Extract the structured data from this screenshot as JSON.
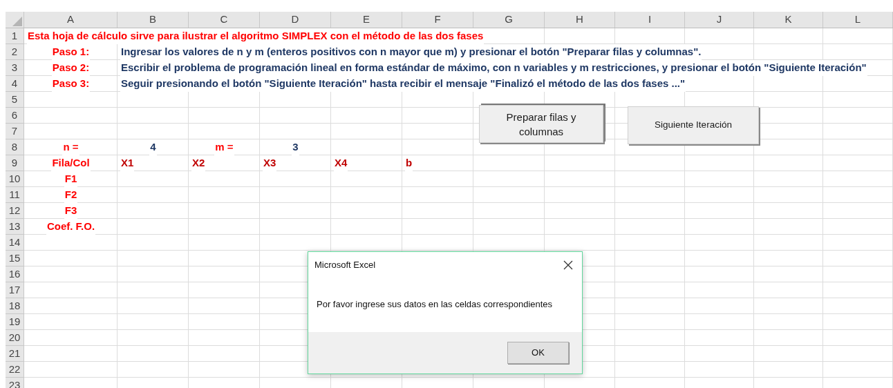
{
  "sheet": {
    "columns": [
      "A",
      "B",
      "C",
      "D",
      "E",
      "F",
      "G",
      "H",
      "I",
      "J",
      "K",
      "L"
    ],
    "rows": [
      {
        "number": "1",
        "cells": [
          {
            "kind": "title",
            "text": "Esta hoja de cálculo sirve para ilustrar el algoritmo SIMPLEX con el método de las dos fases"
          }
        ]
      },
      {
        "number": "2",
        "cells": [
          {
            "kind": "step",
            "text": "Paso 1:"
          }
        ],
        "note": "Ingresar los valores de n y m (enteros positivos con n mayor que m) y presionar el botón \"Preparar filas y columnas\"."
      },
      {
        "number": "3",
        "cells": [
          {
            "kind": "step",
            "text": "Paso 2:"
          }
        ],
        "note": "Escribir el problema de programación lineal en forma estándar de máximo, con n variables y m restricciones, y presionar el botón \"Siguiente Iteración\""
      },
      {
        "number": "4",
        "cells": [
          {
            "kind": "step",
            "text": "Paso 3:"
          }
        ],
        "note": "Seguir presionando el botón \"Siguiente Iteración\" hasta recibir el mensaje \"Finalizó el método de las dos fases ...\""
      },
      {
        "number": "5",
        "cells": []
      },
      {
        "number": "6",
        "cells": []
      },
      {
        "number": "7",
        "cells": []
      },
      {
        "number": "8",
        "cells": [
          {
            "kind": "label",
            "text": "n ="
          },
          {
            "kind": "value",
            "text": "4"
          },
          {
            "kind": "label",
            "text": "m ="
          },
          {
            "kind": "value",
            "text": "3"
          }
        ]
      },
      {
        "number": "9",
        "cells": [
          {
            "kind": "label",
            "text": "Fila/Col"
          },
          {
            "kind": "heading",
            "text": "X1"
          },
          {
            "kind": "heading",
            "text": "X2"
          },
          {
            "kind": "heading",
            "text": "X3"
          },
          {
            "kind": "heading",
            "text": "X4"
          },
          {
            "kind": "heading",
            "text": "b"
          }
        ]
      },
      {
        "number": "10",
        "cells": [
          {
            "kind": "label",
            "text": "F1"
          }
        ]
      },
      {
        "number": "11",
        "cells": [
          {
            "kind": "label",
            "text": "F2"
          }
        ]
      },
      {
        "number": "12",
        "cells": [
          {
            "kind": "label",
            "text": "F3"
          }
        ]
      },
      {
        "number": "13",
        "cells": [
          {
            "kind": "label",
            "text": "Coef. F.O."
          }
        ]
      },
      {
        "number": "14",
        "cells": []
      },
      {
        "number": "15",
        "cells": []
      },
      {
        "number": "16",
        "cells": []
      },
      {
        "number": "17",
        "cells": []
      },
      {
        "number": "18",
        "cells": []
      },
      {
        "number": "19",
        "cells": []
      },
      {
        "number": "20",
        "cells": []
      },
      {
        "number": "21",
        "cells": []
      },
      {
        "number": "22",
        "cells": []
      },
      {
        "number": "23",
        "cells": []
      }
    ]
  },
  "buttons": [
    {
      "label": "Preparar filas y columnas"
    },
    {
      "label": "Siguiente Iteración"
    }
  ],
  "dialog": {
    "title": "Microsoft Excel",
    "message": "Por favor ingrese sus datos en las celdas correspondientes",
    "button": "OK"
  }
}
